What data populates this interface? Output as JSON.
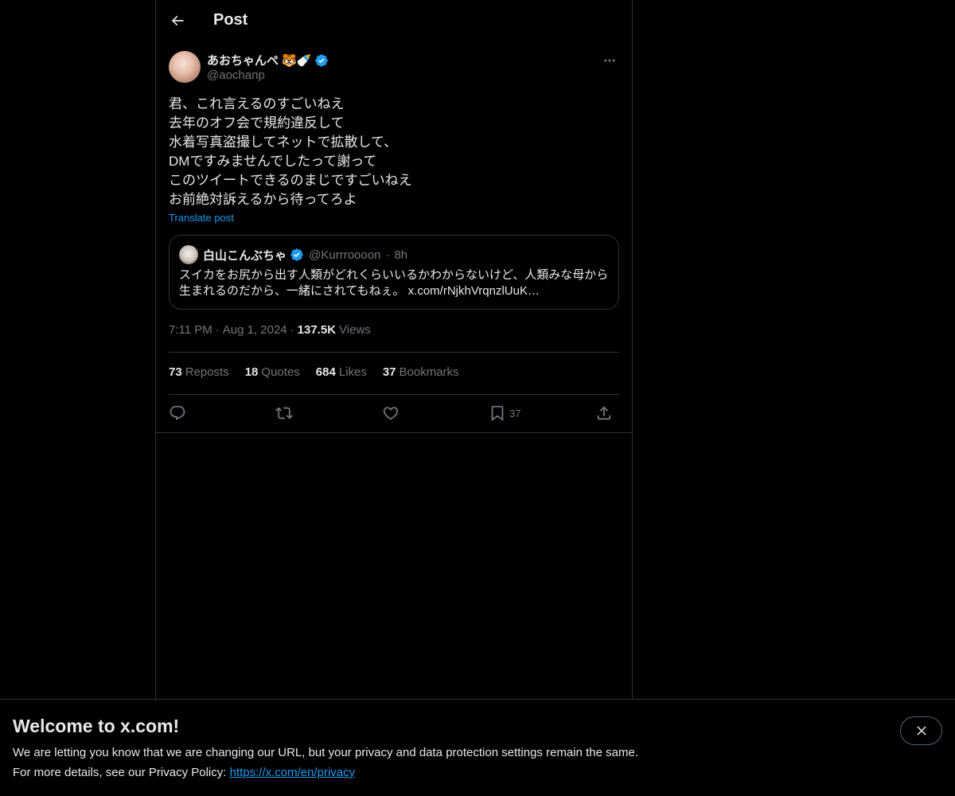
{
  "header": {
    "title": "Post"
  },
  "post": {
    "author": {
      "name": "あおちゃんぺ",
      "emojis": "🐯🍼",
      "handle": "@aochanp"
    },
    "lines": [
      "君、これ言えるのすごいねえ",
      "去年のオフ会で規約違反して",
      "水着写真盗撮してネットで拡散して、",
      "DMですみませんでしたって謝って",
      "このツイートできるのまじですごいねえ",
      "お前絶対訴えるから待ってろよ"
    ],
    "translate": "Translate post",
    "quote": {
      "name": "白山こんぶちゃ",
      "handle": "@Kurrroooon",
      "dot": "·",
      "time": "8h",
      "text": "スイカをお尻から出す人類がどれくらいいるかわからないけど、人類みな母から生まれるのだから、一緒にされてもねぇ。 x.com/rNjkhVrqnzlUuK…"
    },
    "time": "7:11 PM",
    "date": "Aug 1, 2024",
    "sep": "·",
    "views_count": "137.5K",
    "views_label": "Views"
  },
  "stats": [
    {
      "num": "73",
      "label": "Reposts"
    },
    {
      "num": "18",
      "label": "Quotes"
    },
    {
      "num": "684",
      "label": "Likes"
    },
    {
      "num": "37",
      "label": "Bookmarks"
    }
  ],
  "actions": {
    "bookmark_count": "37"
  },
  "banner": {
    "title": "Welcome to x.com!",
    "line1": "We are letting you know that we are changing our URL, but your privacy and data protection settings remain the same.",
    "line2_prefix": "For more details, see our Privacy Policy: ",
    "link": "https://x.com/en/privacy"
  },
  "colors": {
    "accent": "#1d9bf0",
    "background": "#000000",
    "border": "#2f3336",
    "muted": "#71767b",
    "text": "#e7e9ea"
  }
}
